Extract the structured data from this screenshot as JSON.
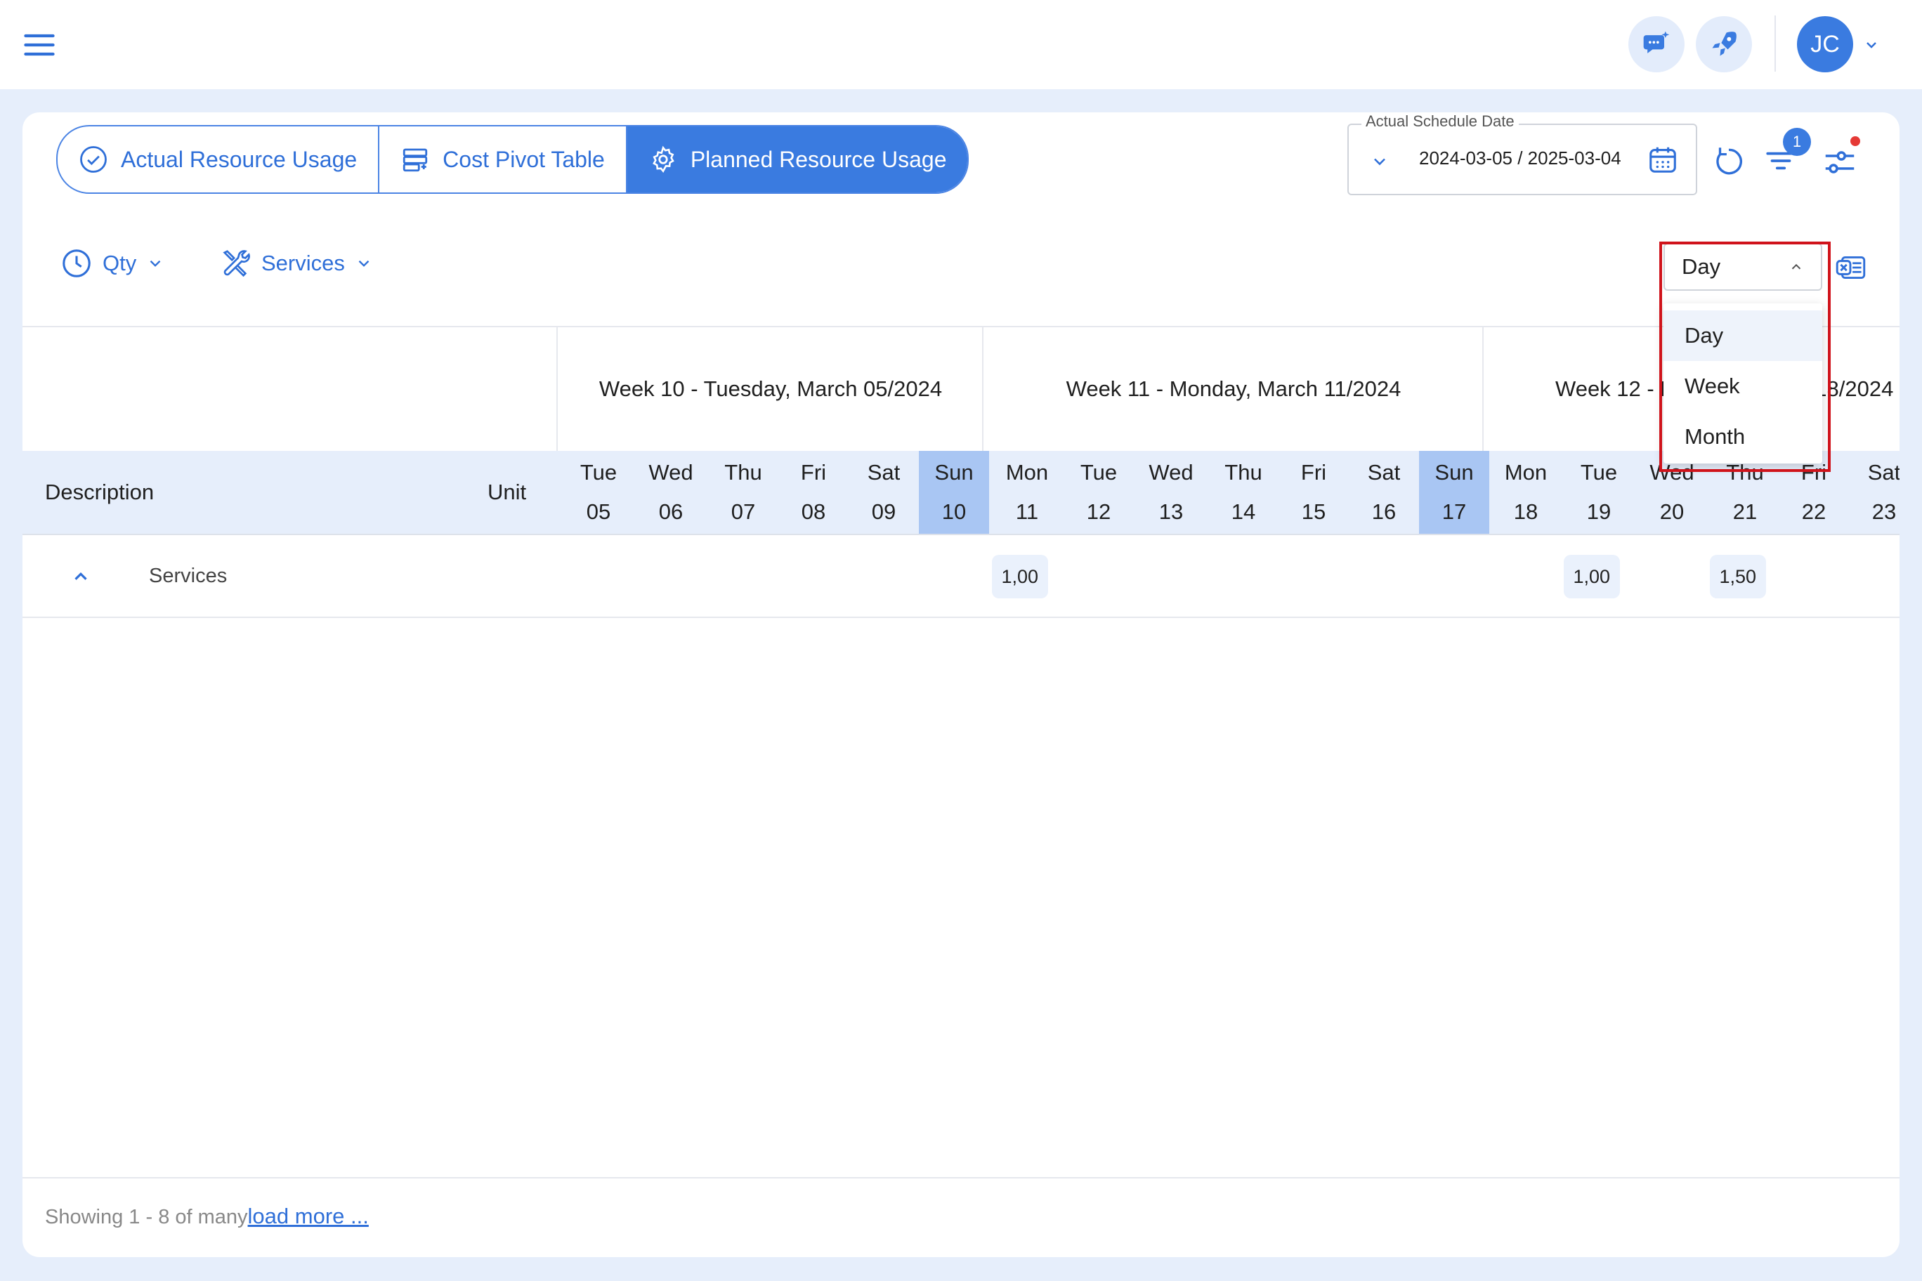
{
  "header": {
    "user_initials": "JC"
  },
  "tabs": [
    {
      "label": "Actual Resource Usage",
      "active": false,
      "icon": "check-circle-icon"
    },
    {
      "label": "Cost Pivot Table",
      "active": false,
      "icon": "table-icon"
    },
    {
      "label": "Planned Resource Usage",
      "active": true,
      "icon": "gear-icon"
    }
  ],
  "date_filter": {
    "label": "Actual Schedule Date",
    "value": "2024-03-05 / 2025-03-04"
  },
  "filter_badge": "1",
  "toolbar": {
    "measure": "Qty",
    "category": "Services",
    "period": "Day"
  },
  "period_options": [
    "Day",
    "Week",
    "Month"
  ],
  "table": {
    "weeks": [
      "Week 10 - Tuesday, March 05/2024",
      "Week 11 - Monday, March 11/2024",
      "Week 12 - Monday, March 18/2024"
    ],
    "description_header": "Description",
    "unit_header": "Unit",
    "days": [
      {
        "name": "Tue",
        "num": "05"
      },
      {
        "name": "Wed",
        "num": "06"
      },
      {
        "name": "Thu",
        "num": "07"
      },
      {
        "name": "Fri",
        "num": "08"
      },
      {
        "name": "Sat",
        "num": "09"
      },
      {
        "name": "Sun",
        "num": "10"
      },
      {
        "name": "Mon",
        "num": "11"
      },
      {
        "name": "Tue",
        "num": "12"
      },
      {
        "name": "Wed",
        "num": "13"
      },
      {
        "name": "Thu",
        "num": "14"
      },
      {
        "name": "Fri",
        "num": "15"
      },
      {
        "name": "Sat",
        "num": "16"
      },
      {
        "name": "Sun",
        "num": "17"
      },
      {
        "name": "Mon",
        "num": "18"
      },
      {
        "name": "Tue",
        "num": "19"
      },
      {
        "name": "Wed",
        "num": "20"
      },
      {
        "name": "Thu",
        "num": "21"
      },
      {
        "name": "Fri",
        "num": "22"
      },
      {
        "name": "Sat",
        "num": "23"
      }
    ],
    "rows": [
      {
        "description": "Services",
        "values": {
          "11": "1,00",
          "19": "1,00",
          "21": "1,50"
        }
      }
    ]
  },
  "footer": {
    "showing": "Showing 1 - 8 of many",
    "load_more": "load more ..."
  },
  "colors": {
    "accent": "#3a7be0",
    "highlight": "#d0131b",
    "weekend": "#a9c6f3"
  }
}
